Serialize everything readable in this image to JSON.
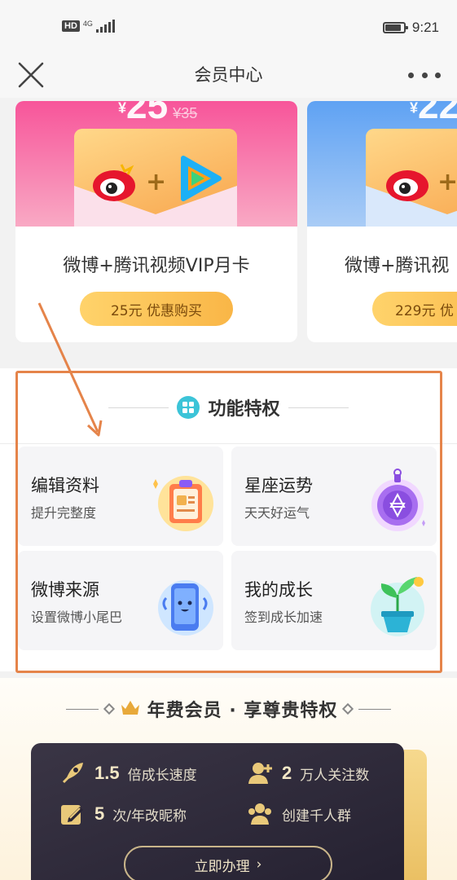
{
  "status_bar": {
    "hd": "HD",
    "network": "4G",
    "time": "9:21",
    "battery_level": 0.8
  },
  "nav": {
    "title": "会员中心",
    "close_icon": "close-icon",
    "more_icon": "more-dots-icon"
  },
  "products": [
    {
      "price": "25",
      "price_currency": "¥",
      "old_price": "¥35",
      "title": "微博+腾讯视频VIP月卡",
      "button": "25元 优惠购买",
      "banner_color": "#f7559a"
    },
    {
      "price": "22",
      "price_currency": "¥",
      "title": "微博+腾讯视",
      "button": "229元 优",
      "banner_color": "#5fa2f3"
    }
  ],
  "features": {
    "title": "功能特权",
    "items": [
      {
        "title": "编辑资料",
        "subtitle": "提升完整度",
        "icon": "clipboard-profile-icon"
      },
      {
        "title": "星座运势",
        "subtitle": "天天好运气",
        "icon": "star-amulet-icon"
      },
      {
        "title": "微博来源",
        "subtitle": "设置微博小尾巴",
        "icon": "phone-mascot-icon"
      },
      {
        "title": "我的成长",
        "subtitle": "签到成长加速",
        "icon": "sprout-pot-icon"
      }
    ]
  },
  "annual": {
    "title": "年费会员 · 享尊贵特权",
    "perks": [
      {
        "num": "1.5",
        "text": "倍成长速度",
        "icon": "rocket-icon"
      },
      {
        "num": "2",
        "text": "万人关注数",
        "icon": "user-plus-icon"
      },
      {
        "num": "5",
        "text": "次/年改昵称",
        "icon": "edit-icon"
      },
      {
        "num": "",
        "text": "创建千人群",
        "icon": "group-icon"
      }
    ],
    "button": "立即办理",
    "button_arrow": "›"
  },
  "colors": {
    "accent_gold": "#f9b647",
    "feature_teal": "#3cc4d8",
    "annotation_orange": "#e5844a"
  }
}
